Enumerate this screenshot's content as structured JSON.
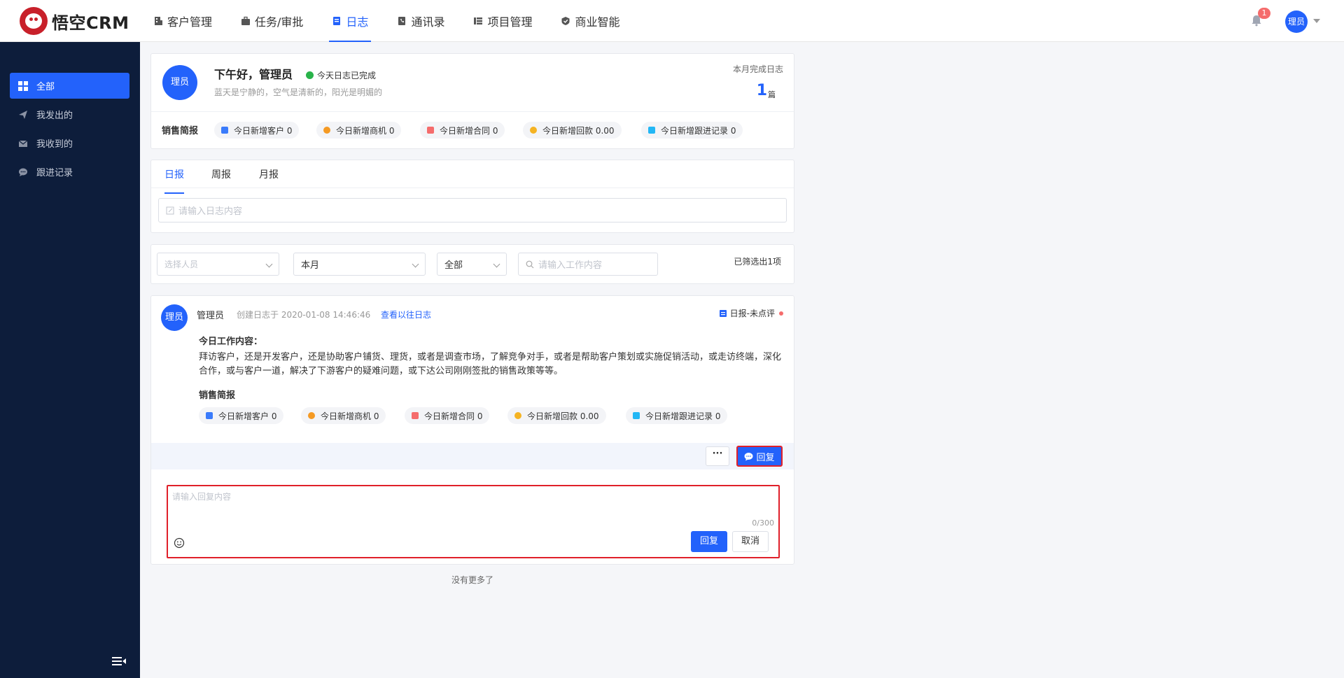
{
  "app": {
    "logo_text": "悟空CRM"
  },
  "nav": {
    "items": [
      {
        "label": "客户管理",
        "icon": "building-icon"
      },
      {
        "label": "任务/审批",
        "icon": "briefcase-icon"
      },
      {
        "label": "日志",
        "icon": "doc-icon",
        "active": true
      },
      {
        "label": "通讯录",
        "icon": "phone-book-icon"
      },
      {
        "label": "项目管理",
        "icon": "list-icon"
      },
      {
        "label": "商业智能",
        "icon": "shield-icon"
      }
    ],
    "notification_count": "1",
    "user_avatar": "理员"
  },
  "sidebar": {
    "items": [
      {
        "label": "全部",
        "icon": "grid-icon",
        "active": true
      },
      {
        "label": "我发出的",
        "icon": "send-icon"
      },
      {
        "label": "我收到的",
        "icon": "mail-icon"
      },
      {
        "label": "跟进记录",
        "icon": "chat-icon"
      }
    ]
  },
  "summary": {
    "avatar": "理员",
    "greeting": "下午好，管理员",
    "status": "今天日志已完成",
    "subtitle": "蓝天是宁静的，空气是清新的，阳光是明媚的",
    "month_label": "本月完成日志",
    "month_count": "1",
    "month_unit": "篇",
    "brief_label": "销售简报",
    "stats": [
      {
        "label": "今日新增客户 0",
        "color": "#3a7bfb"
      },
      {
        "label": "今日新增商机 0",
        "color": "#f59a23"
      },
      {
        "label": "今日新增合同 0",
        "color": "#f56c6c"
      },
      {
        "label": "今日新增回款 0.00",
        "color": "#f5b323"
      },
      {
        "label": "今日新增跟进记录 0",
        "color": "#23b7f5"
      }
    ]
  },
  "composer": {
    "tabs": [
      "日报",
      "周报",
      "月报"
    ],
    "placeholder": "请输入日志内容"
  },
  "filters": {
    "person_placeholder": "选择人员",
    "period_value": "本月",
    "scope_value": "全部",
    "search_placeholder": "请输入工作内容",
    "result_text": "已筛选出1项"
  },
  "log": {
    "avatar": "理员",
    "user": "管理员",
    "created": "创建日志于 2020-01-08 14:46:46",
    "history_link": "查看以往日志",
    "type_label": "日报-未点评",
    "today_title": "今日工作内容：",
    "content": "拜访客户，还是开发客户，还是协助客户铺货、理货，或者是调查市场，了解竞争对手，或者是帮助客户策划或实施促销活动，或走访终端，深化合作，或与客户一道，解决了下游客户的疑难问题，或下达公司刚刚签批的销售政策等等。",
    "brief_title": "销售简报",
    "more_label": "···",
    "reply_label": "回复"
  },
  "reply_box": {
    "placeholder": "请输入回复内容",
    "counter": "0/300",
    "submit_label": "回复",
    "cancel_label": "取消"
  },
  "footer": {
    "no_more": "没有更多了"
  }
}
